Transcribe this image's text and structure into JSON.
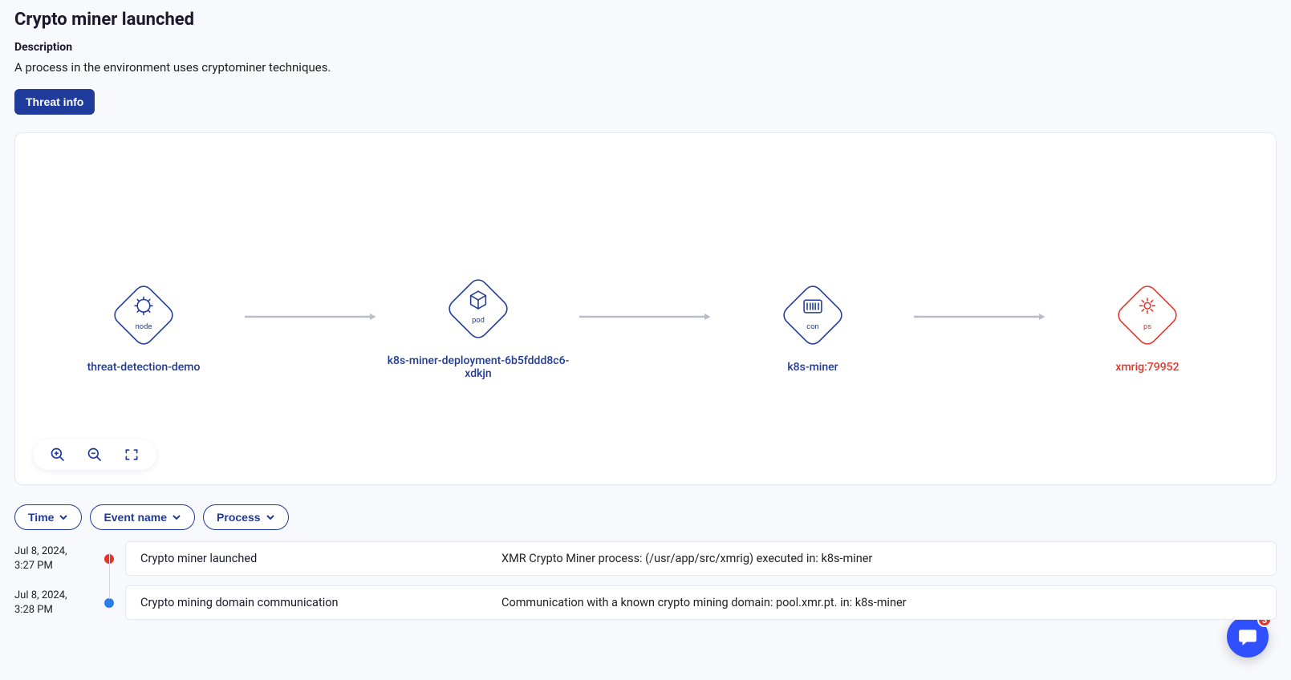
{
  "header": {
    "title": "Crypto miner launched",
    "desc_label": "Description",
    "desc_text": "A process in the environment uses cryptominer techniques.",
    "threat_btn": "Threat info"
  },
  "flow": {
    "nodes": [
      {
        "type": "node",
        "label": "threat-detection-demo",
        "danger": false,
        "icon": "gear-cube"
      },
      {
        "type": "pod",
        "label": "k8s-miner-deployment-6b5fddd8c6-xdkjn",
        "danger": false,
        "icon": "cube"
      },
      {
        "type": "con",
        "label": "k8s-miner",
        "danger": false,
        "icon": "barcode"
      },
      {
        "type": "ps",
        "label": "xmrig:79952",
        "danger": true,
        "icon": "gear"
      }
    ]
  },
  "filters": [
    {
      "label": "Time"
    },
    {
      "label": "Event name"
    },
    {
      "label": "Process"
    }
  ],
  "timeline": [
    {
      "date": "Jul 8, 2024,",
      "time": "3:27 PM",
      "dot": "red",
      "name": "Crypto miner launched",
      "desc": "XMR Crypto Miner process: (/usr/app/src/xmrig) executed in: k8s-miner"
    },
    {
      "date": "Jul 8, 2024,",
      "time": "3:28 PM",
      "dot": "blue",
      "name": "Crypto mining domain communication",
      "desc": "Communication with a known crypto mining domain: pool.xmr.pt. in: k8s-miner"
    }
  ],
  "chat": {
    "badge": "3"
  }
}
